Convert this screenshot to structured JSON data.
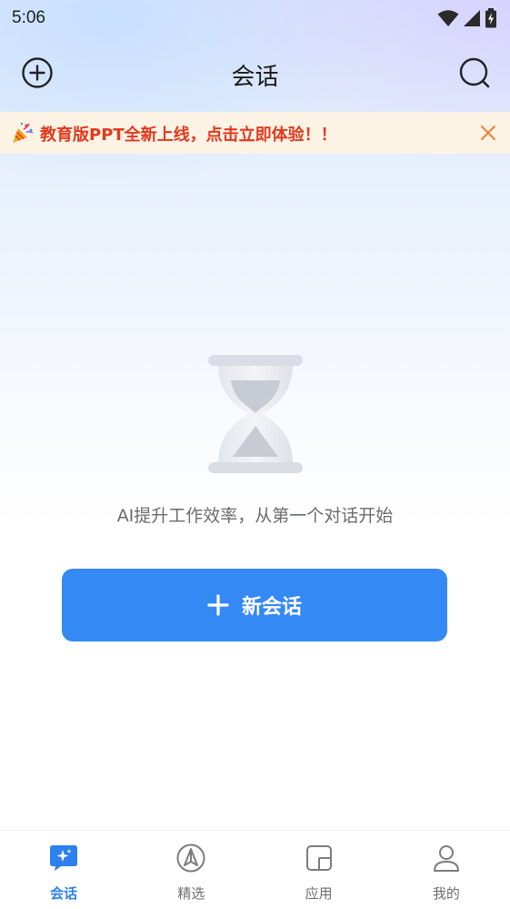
{
  "status_bar": {
    "time": "5:06",
    "icons": [
      "wifi-icon",
      "signal-icon",
      "battery-charging-icon"
    ]
  },
  "header": {
    "title": "会话",
    "left_icon": "add-circle-icon",
    "right_icon": "search-icon"
  },
  "banner": {
    "emoji_icon": "party-popper-icon",
    "text": "教育版PPT全新上线，点击立即体验！！",
    "close_icon": "close-icon",
    "text_color": "#e1391e",
    "background": "#fdf3e4"
  },
  "empty_state": {
    "icon": "hourglass-icon",
    "message": "AI提升工作效率，从第一个对话开始",
    "button_label": "新会话",
    "button_icon": "plus-icon",
    "button_color": "#3589f5"
  },
  "tab_bar": {
    "tabs": [
      {
        "label": "会话",
        "icon": "chat-sparkle-icon",
        "active": true
      },
      {
        "label": "精选",
        "icon": "compass-pen-icon",
        "active": false
      },
      {
        "label": "应用",
        "icon": "apps-icon",
        "active": false
      },
      {
        "label": "我的",
        "icon": "user-icon",
        "active": false
      }
    ],
    "active_color": "#2f80ef"
  }
}
